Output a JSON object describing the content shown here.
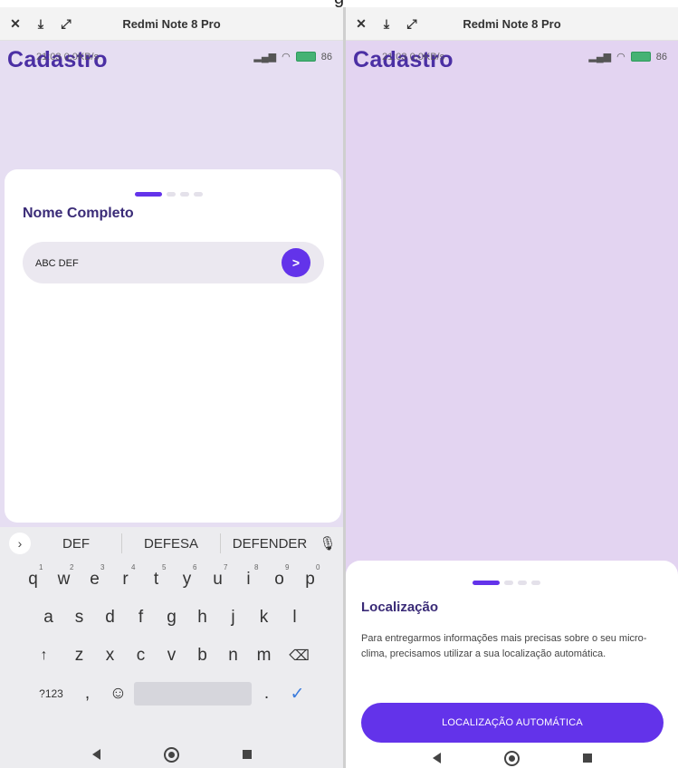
{
  "caption_fragment": "g",
  "device": {
    "name": "Redmi Note 8 Pro",
    "title_icons": [
      "close-icon",
      "download-icon",
      "expand-icon"
    ],
    "status": {
      "time_overlay": "21:03 0,0KB/s",
      "battery": "86"
    }
  },
  "left_screen": {
    "app_title": "Cadastro",
    "field_label": "Nome Completo",
    "input_value": "ABC DEF",
    "go_button": ">",
    "steps": {
      "total": 4,
      "active": 1
    },
    "suggestions": [
      "DEF",
      "DEFESA",
      "DEFENDER"
    ],
    "keyboard": {
      "row1": [
        {
          "k": "q",
          "n": "1"
        },
        {
          "k": "w",
          "n": "2"
        },
        {
          "k": "e",
          "n": "3"
        },
        {
          "k": "r",
          "n": "4"
        },
        {
          "k": "t",
          "n": "5"
        },
        {
          "k": "y",
          "n": "6"
        },
        {
          "k": "u",
          "n": "7"
        },
        {
          "k": "i",
          "n": "8"
        },
        {
          "k": "o",
          "n": "9"
        },
        {
          "k": "p",
          "n": "0"
        }
      ],
      "row2": [
        "a",
        "s",
        "d",
        "f",
        "g",
        "h",
        "j",
        "k",
        "l"
      ],
      "row3": [
        "↑",
        "z",
        "x",
        "c",
        "v",
        "b",
        "n",
        "m",
        "⌫"
      ],
      "row4": {
        "sym": "?123",
        "comma": ",",
        "emoji": "☺",
        "period": ".",
        "enter": "✓"
      }
    }
  },
  "right_screen": {
    "app_title": "Cadastro",
    "section_title": "Localização",
    "description": "Para entregarmos informações mais precisas sobre o seu micro-clima, precisamos utilizar a sua localização automática.",
    "button_label": "LOCALIZAÇÃO AUTOMÁTICA",
    "steps": {
      "total": 4,
      "active": 1
    }
  },
  "colors": {
    "accent": "#6333ea",
    "background": "#e3d4f1",
    "title": "#4b2fa4"
  }
}
